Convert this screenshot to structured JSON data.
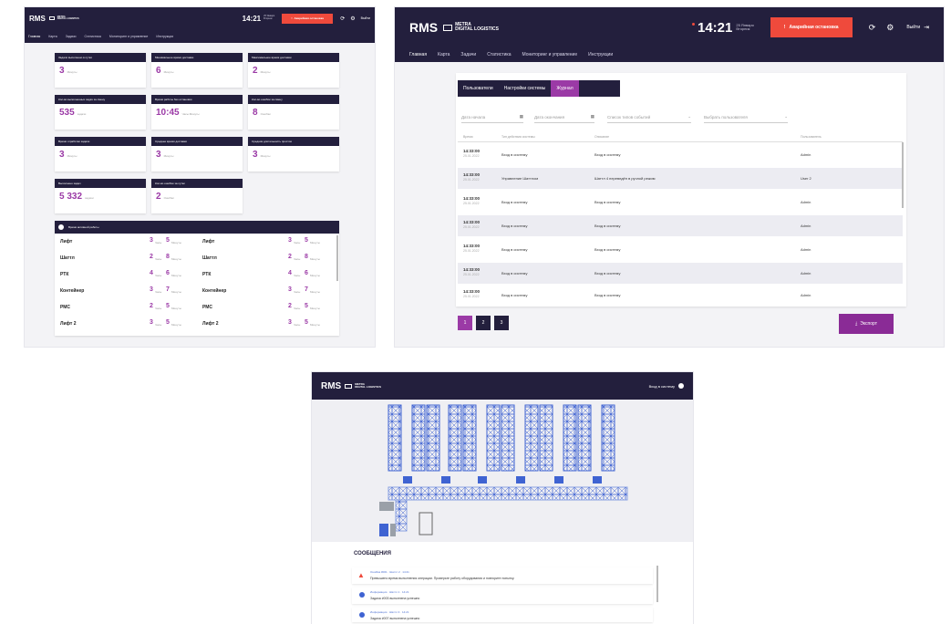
{
  "header": {
    "logo": "RMS",
    "brand_line1": "METRA",
    "brand_line2": "DIGITAL LOGISTICS",
    "time": "14:21",
    "date_line1": "25 Января",
    "date_line2": "Вторник",
    "estop_label": "Аварийная остановка",
    "logout_label": "Выйти",
    "login_label": "Вход в систему"
  },
  "nav": [
    "Главная",
    "Карта",
    "Задачи",
    "Статистика",
    "Мониторинг и управление",
    "Инструкции"
  ],
  "dashboard": {
    "cards": [
      {
        "title": "Задачи выполнено в сутки",
        "value": "3",
        "unit": "Минуты"
      },
      {
        "title": "Минимальное время доставки",
        "value": "6",
        "unit": "Минуты"
      },
      {
        "title": "Максимальное время доставки",
        "value": "2",
        "unit": "Минуты"
      },
      {
        "title": "Кол-во выполненных задач за смену",
        "value": "535",
        "unit": "задачи"
      },
      {
        "title": "Время работы без остановки",
        "value": "10:45",
        "unit": "Часы:Минуты"
      },
      {
        "title": "Кол-во ошибок за смену",
        "value": "8",
        "unit": "Ошибки"
      },
      {
        "title": "Время отработки задачи",
        "value": "3",
        "unit": "Минуты"
      },
      {
        "title": "Среднее время доставки",
        "value": "3",
        "unit": "Минуты"
      },
      {
        "title": "Средняя длительность простоя",
        "value": "3",
        "unit": "Минуты"
      },
      {
        "title": "Выполнено задач",
        "value": "5 332",
        "unit": "задачи"
      },
      {
        "title": "Кол-во ошибок за сутки",
        "value": "2",
        "unit": "Ошибки"
      }
    ],
    "list_title": "Время активной работы",
    "rows": [
      {
        "name": "Лифт",
        "h": "3",
        "m": "5"
      },
      {
        "name": "Шаттл",
        "h": "2",
        "m": "8"
      },
      {
        "name": "РТК",
        "h": "4",
        "m": "6"
      },
      {
        "name": "Контейнер",
        "h": "3",
        "m": "7"
      },
      {
        "name": "РМС",
        "h": "2",
        "m": "5"
      },
      {
        "name": "Лифт 2",
        "h": "3",
        "m": "5"
      }
    ],
    "hour_unit": "Часы",
    "min_unit": "Минуты"
  },
  "journal": {
    "tabs": [
      "Пользователи",
      "Настройки системы",
      "Журнал"
    ],
    "active_tab": 2,
    "filters": {
      "date_from": "Дата начала",
      "date_to": "Дата окончания",
      "event_types": "Список типов событий",
      "user": "Выбрать пользователя"
    },
    "columns": [
      "Время",
      "Тип действия системы",
      "Описание",
      "Пользователь"
    ],
    "rows": [
      {
        "time": "14:33:00",
        "date": "25.01.2022",
        "type": "Вход в систему",
        "desc": "Вход в систему",
        "user": "Admin"
      },
      {
        "time": "14:33:00",
        "date": "25.01.2022",
        "type": "Управление Шаттлом",
        "desc": "Шаттл 4 переведён в ручной режим",
        "user": "User 2"
      },
      {
        "time": "14:33:00",
        "date": "25.01.2022",
        "type": "Вход в систему",
        "desc": "Вход в систему",
        "user": "Admin"
      },
      {
        "time": "14:33:00",
        "date": "25.01.2022",
        "type": "Вход в систему",
        "desc": "Вход в систему",
        "user": "Admin"
      },
      {
        "time": "14:33:00",
        "date": "25.01.2022",
        "type": "Вход в систему",
        "desc": "Вход в систему",
        "user": "Admin"
      },
      {
        "time": "14:33:00",
        "date": "25.01.2022",
        "type": "Вход в систему",
        "desc": "Вход в систему",
        "user": "Admin"
      },
      {
        "time": "14:33:00",
        "date": "25.01.2022",
        "type": "Вход в систему",
        "desc": "Вход в систему",
        "user": "Admin"
      }
    ],
    "pages": [
      "1",
      "2",
      "3"
    ],
    "active_page": 0,
    "export_label": "Экспорт"
  },
  "map_view": {
    "messages_title": "СООБЩЕНИЯ",
    "messages": [
      {
        "icon": "warning-icon",
        "meta": "Ошибка #001 · Шаттл 2 · 14:21",
        "text": "Превышено время выполнения операции. Проверьте работу оборудования и повторите попытку."
      },
      {
        "icon": "info-icon",
        "meta": "Информация · Шаттл 1 · 14:21",
        "text": "Задача #003 выполнена успешно"
      },
      {
        "icon": "info-icon",
        "meta": "Информация · Шаттл 3 · 14:21",
        "text": "Задача #007 выполнена успешно"
      }
    ]
  },
  "colors": {
    "header": "#231f3d",
    "accent": "#9b3aa6",
    "estop": "#ef4a3c",
    "rack": "#3f63d2"
  }
}
